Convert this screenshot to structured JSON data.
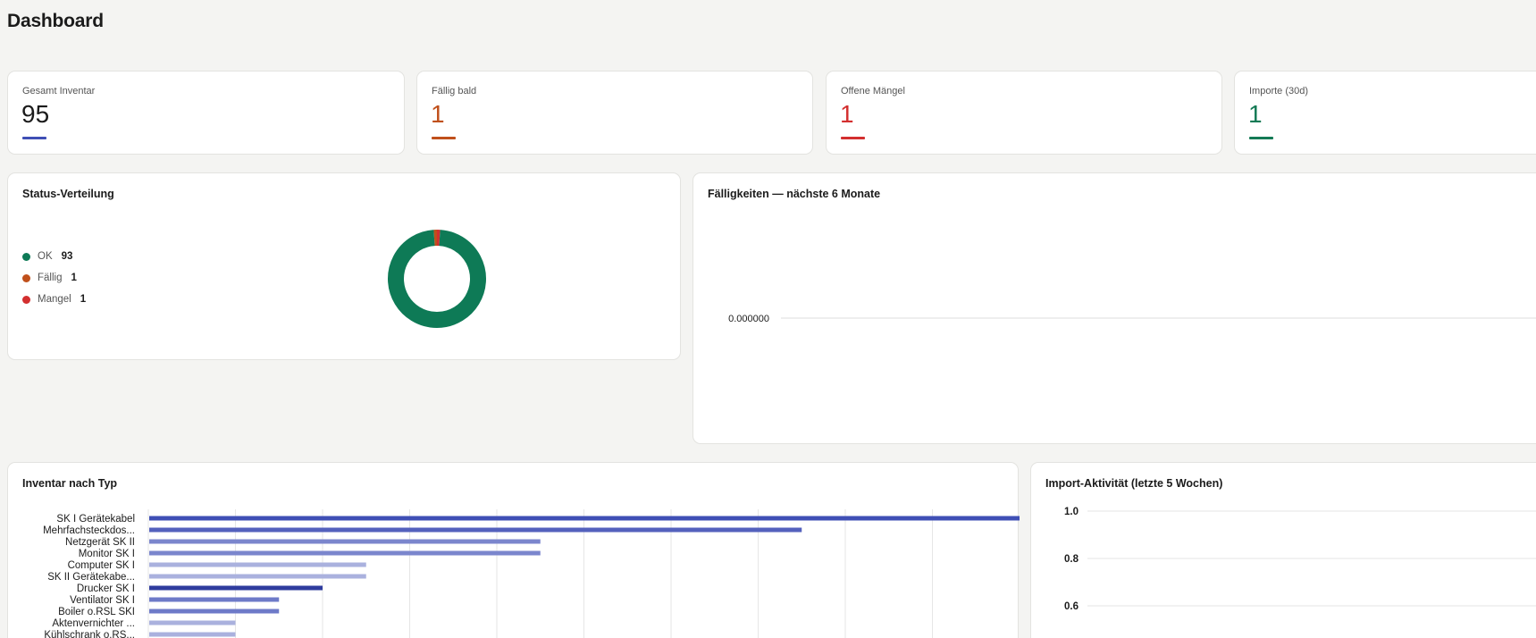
{
  "header": {
    "title": "Dashboard"
  },
  "stats": [
    {
      "label": "Gesamt Inventar",
      "value": "95",
      "color": "#3f4fb5"
    },
    {
      "label": "Fällig bald",
      "value": "1",
      "color": "#c0501b"
    },
    {
      "label": "Offene Mängel",
      "value": "1",
      "color": "#d32f2f"
    },
    {
      "label": "Importe (30d)",
      "value": "1",
      "color": "#147a55"
    }
  ],
  "status_card": {
    "title": "Status-Verteilung",
    "legend": [
      {
        "name": "OK",
        "count": "93",
        "color": "#0e7a56",
        "icon": "dot-icon"
      },
      {
        "name": "Fällig",
        "count": "1",
        "color": "#c0501b",
        "icon": "dot-icon"
      },
      {
        "name": "Mangel",
        "count": "1",
        "color": "#d32f2f",
        "icon": "dot-icon"
      }
    ]
  },
  "due_card": {
    "title": "Fälligkeiten — nächste 6 Monate"
  },
  "type_card": {
    "title": "Inventar nach Typ"
  },
  "import_card": {
    "title": "Import-Aktivität (letzte 5 Wochen)"
  },
  "chart_data": [
    {
      "type": "pie",
      "categories": [
        "OK",
        "Fällig",
        "Mangel"
      ],
      "values": [
        93,
        1,
        1
      ],
      "colors": [
        "#0e7a56",
        "#c0501b",
        "#d32f2f"
      ]
    },
    {
      "type": "line",
      "title": "Fälligkeiten — nächste 6 Monate",
      "y_ticks": [
        "0.000000"
      ],
      "grid": true
    },
    {
      "type": "bar",
      "orientation": "horizontal",
      "title": "Inventar nach Typ",
      "categories": [
        "SK I Gerätekabel",
        "Mehrfachsteckdos...",
        "Netzgerät SK II",
        "Monitor SK I",
        "Computer SK I",
        "SK II Gerätekabe...",
        "Drucker SK I",
        "Ventilator SK I",
        "Boiler o.RSL SKI",
        "Aktenvernichter ...",
        "Kühlschrank o.RS..."
      ],
      "values": [
        10,
        7.5,
        4.5,
        4.5,
        2.5,
        2.5,
        2,
        1.5,
        1.5,
        1,
        1
      ],
      "colors": [
        "#3f4fb5",
        "#5461bd",
        "#7b86cd",
        "#7b86cd",
        "#aab1de",
        "#aab1de",
        "#2f3c9e",
        "#6e7ac8",
        "#6e7ac8",
        "#aab1de",
        "#aab1de"
      ],
      "xlim": [
        0,
        10
      ],
      "grid": true
    },
    {
      "type": "line",
      "title": "Import-Aktivität (letzte 5 Wochen)",
      "y_ticks": [
        "1.0",
        "0.8",
        "0.6"
      ],
      "grid": true
    }
  ]
}
